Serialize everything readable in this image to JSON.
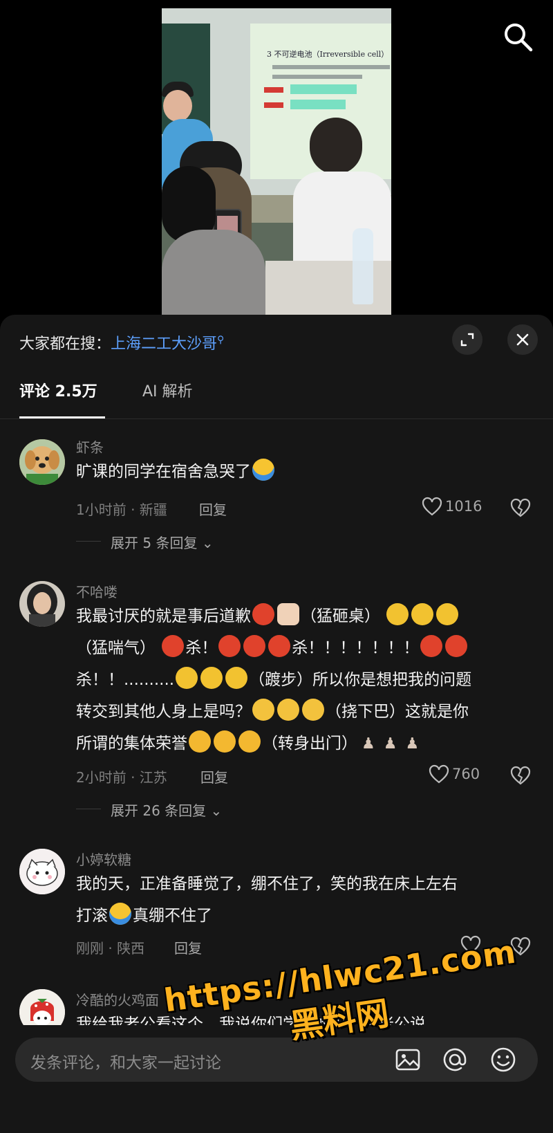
{
  "search_bar": {
    "prefix": "大家都在搜：",
    "term": "上海二工大沙哥"
  },
  "video": {
    "slide_title": "3 不可逆电池（Irreversible cell）"
  },
  "tabs": [
    {
      "label": "评论 2.5万"
    },
    {
      "label": "AI 解析"
    }
  ],
  "comments": [
    {
      "username": "虾条",
      "text": "旷课的同学在宿舍急哭了",
      "time_location": "1小时前 · 新疆",
      "reply_label": "回复",
      "likes": "1016",
      "expand_label": "展开 5 条回复"
    },
    {
      "username": "不哈喽",
      "line1_a": "我最讨厌的就是事后道歉",
      "line1_b": "（猛砸桌）",
      "line2_a": "（猛喘气）",
      "line2_b": "杀！",
      "line2_c": "杀！！！！！！！",
      "line3_a": "杀！！..........",
      "line3_b": "（踱步）所以你是想把我的问题",
      "line4_a": "转交到其他人身上是吗？",
      "line4_b": "（挠下巴）这就是你",
      "line5_a": "所谓的集体荣誉",
      "line5_b": "（转身出门）",
      "time_location": "2小时前 · 江苏",
      "reply_label": "回复",
      "likes": "760",
      "expand_label": "展开 26 条回复"
    },
    {
      "username": "小婷软糖",
      "line1": "我的天，正准备睡觉了，绷不住了，笑的我在床上左右",
      "line2_a": "打滚",
      "line2_b": "真绷不住了",
      "time_location": "刚刚 · 陕西",
      "reply_label": "回复"
    },
    {
      "username": "冷酷的火鸡面",
      "text": "我给我老公看这个，我说你们学校的吗，我老公说"
    }
  ],
  "input": {
    "placeholder": "发条评论，和大家一起讨论"
  },
  "watermark": {
    "url": "https://hlwc21.com",
    "name": "黑料网"
  },
  "colors": {
    "sheet_bg": "#161616",
    "search_term": "#5ea1ff",
    "watermark": "#ffb21e"
  }
}
